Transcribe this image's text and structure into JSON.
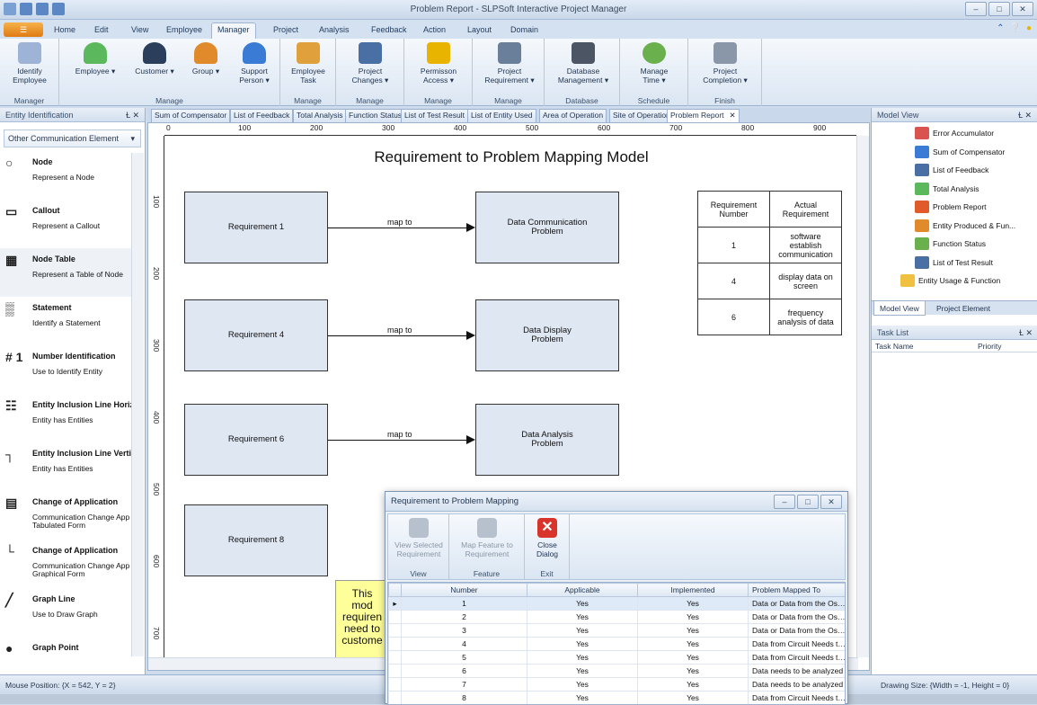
{
  "window": {
    "title": "Problem Report - SLPSoft Interactive Project Manager"
  },
  "menu": {
    "app_button": "☰",
    "tabs": [
      "Home",
      "Edit",
      "View",
      "Employee",
      "Manager",
      "Project",
      "Analysis",
      "Feedback",
      "Action",
      "Layout",
      "Domain"
    ],
    "active_tab": "Manager"
  },
  "ribbon": {
    "groups": [
      {
        "label": "Manager",
        "buttons": [
          {
            "label": "Identify\nEmployee",
            "icon": "id-card-icon"
          }
        ]
      },
      {
        "label": "Manage",
        "buttons": [
          {
            "label": "Employee ▾",
            "icon": "employee-icon"
          },
          {
            "label": "Customer ▾",
            "icon": "customer-icon"
          },
          {
            "label": "Group ▾",
            "icon": "group-icon"
          },
          {
            "label": "Support\nPerson ▾",
            "icon": "support-person-icon"
          }
        ]
      },
      {
        "label": "Manage",
        "buttons": [
          {
            "label": "Employee\nTask",
            "icon": "employee-task-icon"
          }
        ]
      },
      {
        "label": "Manage",
        "buttons": [
          {
            "label": "Project\nChanges ▾",
            "icon": "project-changes-icon"
          }
        ]
      },
      {
        "label": "Manage",
        "buttons": [
          {
            "label": "Permisson\nAccess ▾",
            "icon": "lock-icon"
          }
        ]
      },
      {
        "label": "Manage",
        "buttons": [
          {
            "label": "Project\nRequirement ▾",
            "icon": "requirement-icon"
          }
        ]
      },
      {
        "label": "Database",
        "buttons": [
          {
            "label": "Database\nManagement ▾",
            "icon": "database-icon"
          }
        ]
      },
      {
        "label": "Schedule",
        "buttons": [
          {
            "label": "Manage\nTime ▾",
            "icon": "clock-icon"
          }
        ]
      },
      {
        "label": "Finish",
        "buttons": [
          {
            "label": "Project\nCompletion ▾",
            "icon": "tools-icon"
          }
        ]
      }
    ]
  },
  "left_pane": {
    "title": "Entity Identification",
    "pin": "Ɫ ✕",
    "combo": "Other Communication Element",
    "items": [
      {
        "icon": "node-icon",
        "glyph": "○",
        "name": "Node",
        "desc": "Represent a Node"
      },
      {
        "icon": "callout-icon",
        "glyph": "▭",
        "name": "Callout",
        "desc": "Represent a Callout"
      },
      {
        "icon": "node-table-icon",
        "glyph": "▦",
        "name": "Node Table",
        "desc": "Represent a Table of Node"
      },
      {
        "icon": "statement-icon",
        "glyph": "▒",
        "name": "Statement",
        "desc": "Identify a Statement"
      },
      {
        "icon": "number-icon",
        "glyph": "# 1",
        "name": "Number Identification",
        "desc": "Use to Identify Entity"
      },
      {
        "icon": "hierarchy-horizontal-icon",
        "glyph": "☷",
        "name": "Entity Inclusion Line Horiz",
        "desc": "Entity has Entities"
      },
      {
        "icon": "hierarchy-vertical-icon",
        "glyph": "┐",
        "name": "Entity Inclusion Line Verti",
        "desc": "Entity has Entities"
      },
      {
        "icon": "table-icon",
        "glyph": "▤",
        "name": "Change of Application",
        "desc": "Communication Change App\nTabulated Form"
      },
      {
        "icon": "graphical-icon",
        "glyph": "└",
        "name": "Change of Application",
        "desc": "Communication Change App\nGraphical Form"
      },
      {
        "icon": "graph-line-icon",
        "glyph": "╱",
        "name": "Graph Line",
        "desc": "Use to Draw Graph"
      },
      {
        "icon": "graph-point-icon",
        "glyph": "●",
        "name": "Graph Point",
        "desc": ""
      }
    ]
  },
  "doc_tabs": [
    "Sum of Compensator",
    "List of Feedback",
    "Total Analysis",
    "Function Status",
    "List of Test Result",
    "List of Entity Used",
    "Area of Operation",
    "Site of Operation",
    "Problem Report"
  ],
  "doc_tab_close": "✕",
  "ruler": {
    "h": [
      "0",
      "100",
      "200",
      "300",
      "400",
      "500",
      "600",
      "700",
      "800",
      "900"
    ],
    "v": [
      "100",
      "200",
      "300",
      "400",
      "500",
      "600",
      "700"
    ]
  },
  "diagram": {
    "title": "Requirement to Problem Mapping Model",
    "map_label": "map to",
    "requirements": [
      "Requirement 1",
      "Requirement 4",
      "Requirement 6",
      "Requirement 8"
    ],
    "problems": [
      "Data Communication\nProblem",
      "Data Display\nProblem",
      "Data Analysis\nProblem"
    ],
    "table_headers": [
      "Requirement\nNumber",
      "Actual\nRequirement"
    ],
    "table_rows": [
      {
        "num": "1",
        "req": "software\nestablish\ncommunication"
      },
      {
        "num": "4",
        "req": "display data on\nscreen"
      },
      {
        "num": "6",
        "req": "frequency\nanalysis of data"
      }
    ],
    "note": "This mod requiren need to custome"
  },
  "model_view": {
    "title": "Model View",
    "items": [
      {
        "label": "Error Accumulator",
        "color": "#d9534f"
      },
      {
        "label": "Sum of Compensator",
        "color": "#3a7bd5"
      },
      {
        "label": "List of Feedback",
        "color": "#4a6fa5"
      },
      {
        "label": "Total Analysis",
        "color": "#5cb85c"
      },
      {
        "label": "Problem Report",
        "color": "#e05a2b"
      },
      {
        "label": "Entity Produced & Fun...",
        "color": "#e08a2b"
      },
      {
        "label": "Function Status",
        "color": "#6ab04c"
      },
      {
        "label": "List of Test Result",
        "color": "#4a6fa5"
      },
      {
        "label": "Entity Usage & Function",
        "color": "#f0c040"
      }
    ],
    "tabs": [
      "Model View",
      "Project Element"
    ]
  },
  "task_list": {
    "title": "Task List",
    "col_name": "Task Name",
    "col_priority": "Priority"
  },
  "status": {
    "mouse": "Mouse Position: {X = 542,  Y = 2}",
    "drawing": "Drawing Size: {Width = -1, Height = 0}"
  },
  "dialog": {
    "title": "Requirement to Problem Mapping",
    "groups": [
      {
        "label": "View",
        "button": "View Selected\nRequirement",
        "icon": "view-requirement-icon",
        "enabled": false
      },
      {
        "label": "Feature",
        "button": "Map Feature to\nRequirement",
        "icon": "map-feature-icon",
        "enabled": false
      },
      {
        "label": "Exit",
        "button": "Close\nDialog",
        "icon": "close-dialog-icon",
        "enabled": true
      }
    ],
    "columns": [
      "Number",
      "Applicable",
      "Implemented",
      "Problem Mapped To"
    ],
    "rows": [
      {
        "n": "1",
        "a": "Yes",
        "i": "Yes",
        "p": "Data or Data from the Oscillosc..."
      },
      {
        "n": "2",
        "a": "Yes",
        "i": "Yes",
        "p": "Data or Data from the Oscillosc..."
      },
      {
        "n": "3",
        "a": "Yes",
        "i": "Yes",
        "p": "Data or Data from the Oscillosc..."
      },
      {
        "n": "4",
        "a": "Yes",
        "i": "Yes",
        "p": "Data from Circuit Needs to Displ..."
      },
      {
        "n": "5",
        "a": "Yes",
        "i": "Yes",
        "p": "Data from Circuit Needs to Displ..."
      },
      {
        "n": "6",
        "a": "Yes",
        "i": "Yes",
        "p": "Data needs to be analyzed"
      },
      {
        "n": "7",
        "a": "Yes",
        "i": "Yes",
        "p": "Data needs to be analyzed"
      },
      {
        "n": "8",
        "a": "Yes",
        "i": "Yes",
        "p": "Data from Circuit Needs to Displ..."
      }
    ]
  }
}
